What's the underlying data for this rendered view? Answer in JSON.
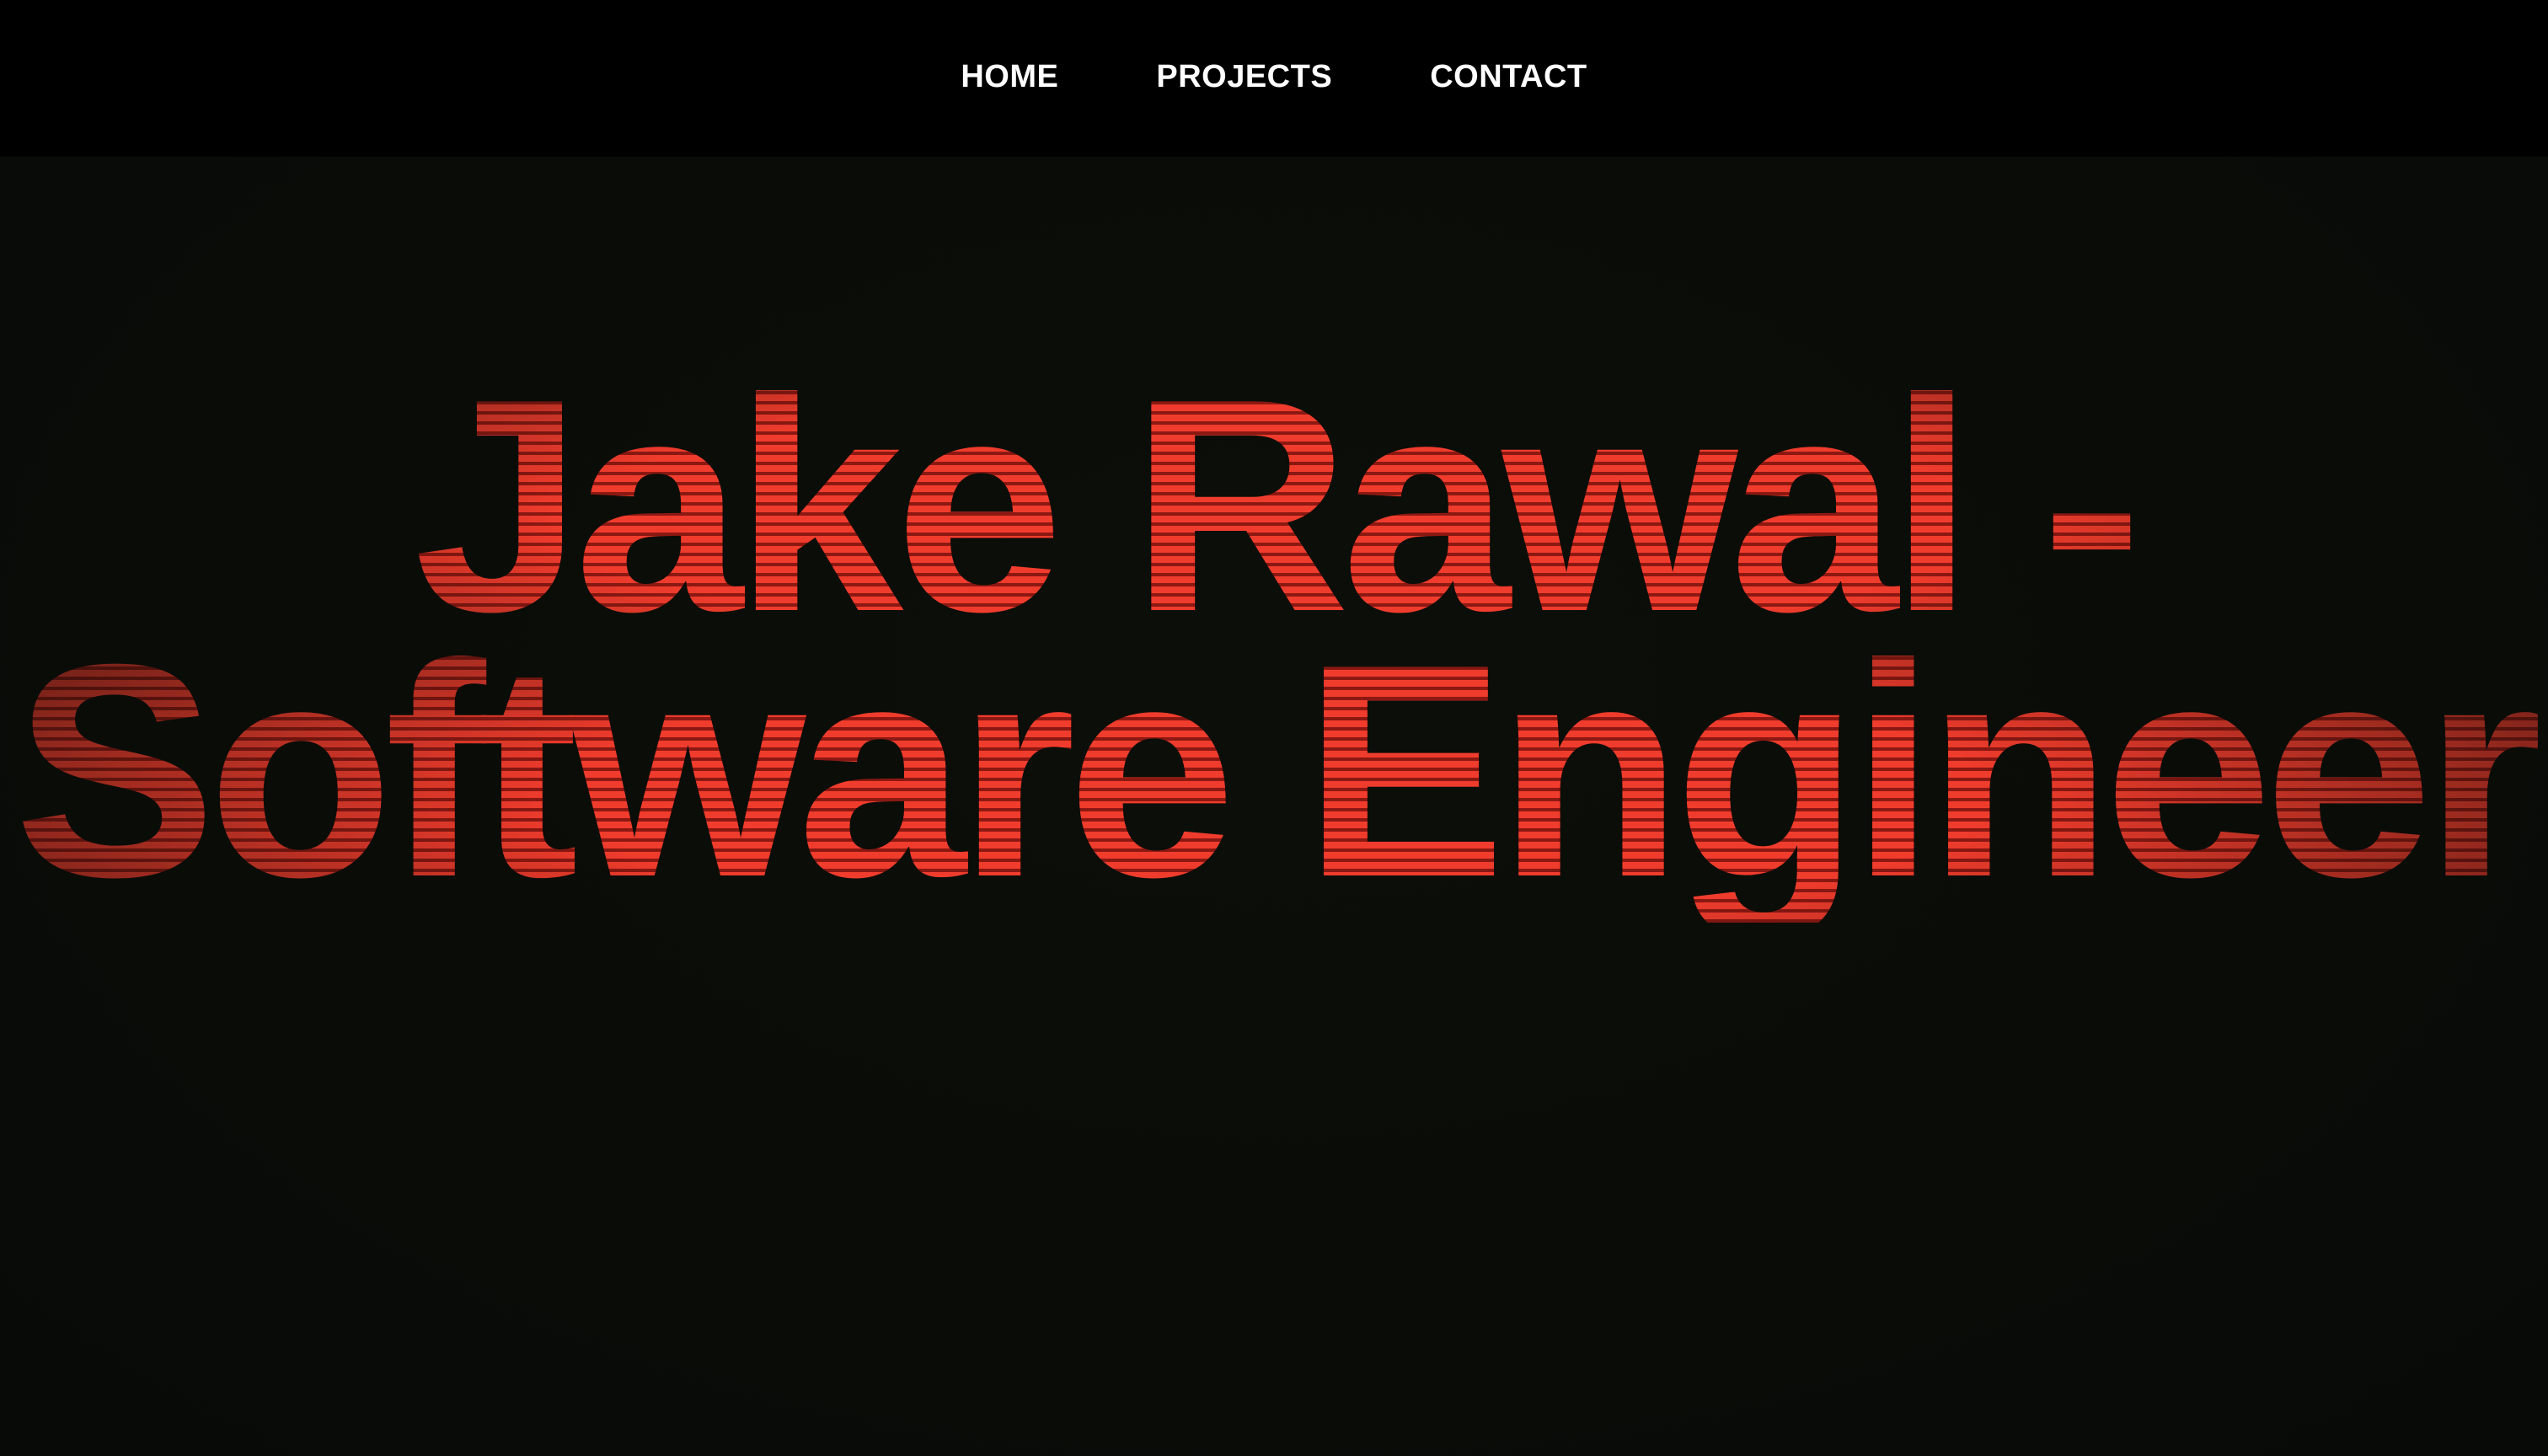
{
  "nav": {
    "items": [
      {
        "label": "HOME"
      },
      {
        "label": "PROJECTS"
      },
      {
        "label": "CONTACT"
      }
    ]
  },
  "hero": {
    "title_line1": "Jake Rawal -",
    "title_line2": "Software Engineer"
  },
  "colors": {
    "nav_background": "#000000",
    "page_background": "#0a0c08",
    "nav_text": "#ffffff",
    "title_red": "#f03c2d",
    "title_stripe_dark": "#8c1812"
  }
}
